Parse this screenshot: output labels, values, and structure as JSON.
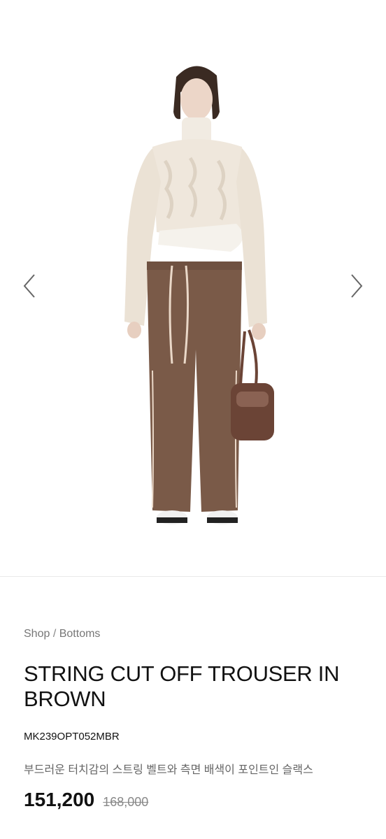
{
  "gallery": {
    "prev_icon": "chevron-left-icon",
    "next_icon": "chevron-right-icon",
    "image_alt": "Model wearing cream cable knit sweater and brown string cut off trousers"
  },
  "breadcrumb": {
    "shop": "Shop",
    "separator": "/",
    "category": "Bottoms"
  },
  "product": {
    "title": "STRING CUT OFF TROUSER IN BROWN",
    "sku": "MK239OPT052MBR",
    "description": "부드러운 터치감의 스트링 벨트와 측면 배색이 포인트인 슬랙스",
    "price": "151,200",
    "original_price": "168,000"
  },
  "colors": {
    "trouser": "#7a5a48",
    "sweater": "#efe7dc",
    "bag": "#6b4436",
    "text": "#111111",
    "muted": "#777777"
  }
}
